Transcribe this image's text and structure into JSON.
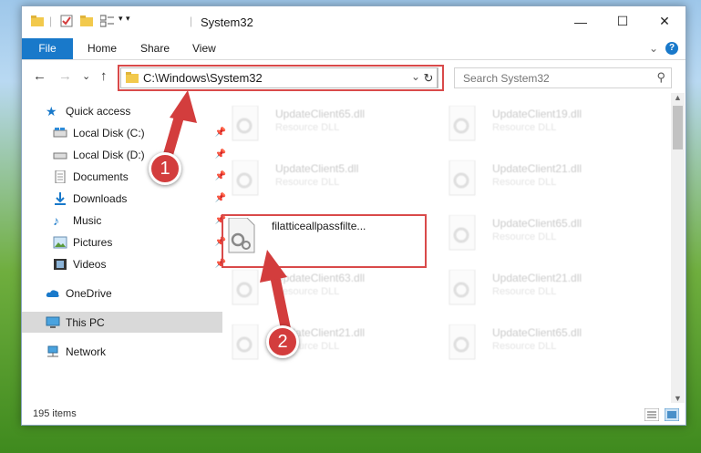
{
  "window": {
    "title": "System32",
    "minimize": "—",
    "maximize": "☐",
    "close": "✕"
  },
  "ribbon": {
    "tabs": [
      "File",
      "Home",
      "Share",
      "View"
    ],
    "collapse": "⌄",
    "help": "?"
  },
  "nav": {
    "back": "←",
    "forward": "→",
    "recent": "⌄",
    "up": "↑",
    "address": "C:\\Windows\\System32",
    "dropdown": "⌄",
    "refresh": "↻",
    "search_placeholder": "Search System32"
  },
  "sidebar": {
    "items": [
      {
        "label": "Quick access"
      },
      {
        "label": "Local Disk (C:)"
      },
      {
        "label": "Local Disk (D:)"
      },
      {
        "label": "Documents"
      },
      {
        "label": "Downloads"
      },
      {
        "label": "Music"
      },
      {
        "label": "Pictures"
      },
      {
        "label": "Videos"
      },
      {
        "label": "OneDrive"
      },
      {
        "label": "This PC"
      },
      {
        "label": "Network"
      }
    ]
  },
  "files": {
    "highlighted": {
      "name": "filatticeallpassfilte..."
    },
    "faded": [
      {
        "name": "UpdateClient65.dll",
        "desc": "Resource DLL"
      },
      {
        "name": "UpdateClient19.dll",
        "desc": "Resource DLL"
      },
      {
        "name": "UpdateClient5.dll",
        "desc": "Resource DLL"
      },
      {
        "name": "UpdateClient21.dll",
        "desc": "Resource DLL"
      },
      {
        "name": "UpdateClient65.dll",
        "desc": "Resource DLL"
      },
      {
        "name": "UpdateClient63.dll",
        "desc": "Resource DLL"
      },
      {
        "name": "UpdateClient21.dll",
        "desc": "Resource DLL"
      },
      {
        "name": "UpdateClient21.dll",
        "desc": "Resource DLL"
      },
      {
        "name": "UpdateClient65.dll",
        "desc": "Resource DLL"
      }
    ]
  },
  "status": {
    "count": "195 items"
  },
  "badges": {
    "one": "1",
    "two": "2"
  },
  "colors": {
    "accent": "#1979ca",
    "highlight": "#d94a4a",
    "folder": "#f2c94c"
  }
}
